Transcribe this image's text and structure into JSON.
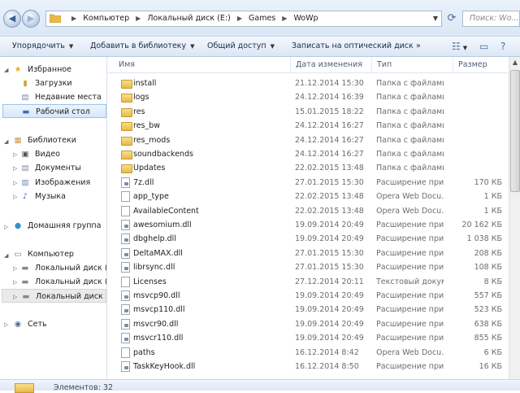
{
  "address": {
    "crumbs": [
      "Компьютер",
      "Локальный диск (E:)",
      "Games",
      "WoWp"
    ],
    "search_placeholder": "Поиск: Wo..."
  },
  "toolbar": {
    "organize": "Упорядочить",
    "add_library": "Добавить в библиотеку",
    "share": "Общий доступ",
    "burn": "Записать на оптический диск",
    "more": "»"
  },
  "sidebar": {
    "favorites": "Избранное",
    "downloads": "Загрузки",
    "recent": "Недавние места",
    "desktop": "Рабочий стол",
    "libraries": "Библиотеки",
    "video": "Видео",
    "documents": "Документы",
    "images": "Изображения",
    "music": "Музыка",
    "homegroup": "Домашняя группа",
    "computer": "Компьютер",
    "disk_c": "Локальный диск (C:)",
    "disk_d": "Локальный диск (D:)",
    "disk_e": "Локальный диск (E:)",
    "network": "Сеть"
  },
  "columns": {
    "name": "Имя",
    "date": "Дата изменения",
    "type": "Тип",
    "size": "Размер"
  },
  "files": [
    {
      "name": "install",
      "date": "21.12.2014 15:30",
      "type": "Папка с файлами",
      "size": "",
      "kind": "folder"
    },
    {
      "name": "logs",
      "date": "24.12.2014 16:39",
      "type": "Папка с файлами",
      "size": "",
      "kind": "folder"
    },
    {
      "name": "res",
      "date": "15.01.2015 18:22",
      "type": "Папка с файлами",
      "size": "",
      "kind": "folder"
    },
    {
      "name": "res_bw",
      "date": "24.12.2014 16:27",
      "type": "Папка с файлами",
      "size": "",
      "kind": "folder"
    },
    {
      "name": "res_mods",
      "date": "24.12.2014 16:27",
      "type": "Папка с файлами",
      "size": "",
      "kind": "folder"
    },
    {
      "name": "soundbackends",
      "date": "24.12.2014 16:27",
      "type": "Папка с файлами",
      "size": "",
      "kind": "folder"
    },
    {
      "name": "Updates",
      "date": "22.02.2015 13:48",
      "type": "Папка с файлами",
      "size": "",
      "kind": "folder"
    },
    {
      "name": "7z.dll",
      "date": "27.01.2015 15:30",
      "type": "Расширение при...",
      "size": "170 КБ",
      "kind": "dll"
    },
    {
      "name": "app_type",
      "date": "22.02.2015 13:48",
      "type": "Opera Web Docu...",
      "size": "1 КБ",
      "kind": "file"
    },
    {
      "name": "AvailableContent",
      "date": "22.02.2015 13:48",
      "type": "Opera Web Docu...",
      "size": "1 КБ",
      "kind": "file"
    },
    {
      "name": "awesomium.dll",
      "date": "19.09.2014 20:49",
      "type": "Расширение при...",
      "size": "20 162 КБ",
      "kind": "dll"
    },
    {
      "name": "dbghelp.dll",
      "date": "19.09.2014 20:49",
      "type": "Расширение при...",
      "size": "1 038 КБ",
      "kind": "dll"
    },
    {
      "name": "DeltaMAX.dll",
      "date": "27.01.2015 15:30",
      "type": "Расширение при...",
      "size": "208 КБ",
      "kind": "dll"
    },
    {
      "name": "librsync.dll",
      "date": "27.01.2015 15:30",
      "type": "Расширение при...",
      "size": "108 КБ",
      "kind": "dll"
    },
    {
      "name": "Licenses",
      "date": "27.12.2014 20:11",
      "type": "Текстовый докум...",
      "size": "8 КБ",
      "kind": "file"
    },
    {
      "name": "msvcp90.dll",
      "date": "19.09.2014 20:49",
      "type": "Расширение при...",
      "size": "557 КБ",
      "kind": "dll"
    },
    {
      "name": "msvcp110.dll",
      "date": "19.09.2014 20:49",
      "type": "Расширение при...",
      "size": "523 КБ",
      "kind": "dll"
    },
    {
      "name": "msvcr90.dll",
      "date": "19.09.2014 20:49",
      "type": "Расширение при...",
      "size": "638 КБ",
      "kind": "dll"
    },
    {
      "name": "msvcr110.dll",
      "date": "19.09.2014 20:49",
      "type": "Расширение при...",
      "size": "855 КБ",
      "kind": "dll"
    },
    {
      "name": "paths",
      "date": "16.12.2014 8:42",
      "type": "Opera Web Docu...",
      "size": "6 КБ",
      "kind": "file"
    },
    {
      "name": "TaskKeyHook.dll",
      "date": "16.12.2014 8:50",
      "type": "Расширение при...",
      "size": "16 КБ",
      "kind": "dll"
    }
  ],
  "status": {
    "items": "Элементов: 32"
  },
  "icons": {
    "back": "back-arrow-icon",
    "forward": "forward-arrow-icon",
    "refresh": "refresh-icon",
    "folder": "folder-icon",
    "file": "document-icon",
    "dll": "dll-file-icon"
  }
}
